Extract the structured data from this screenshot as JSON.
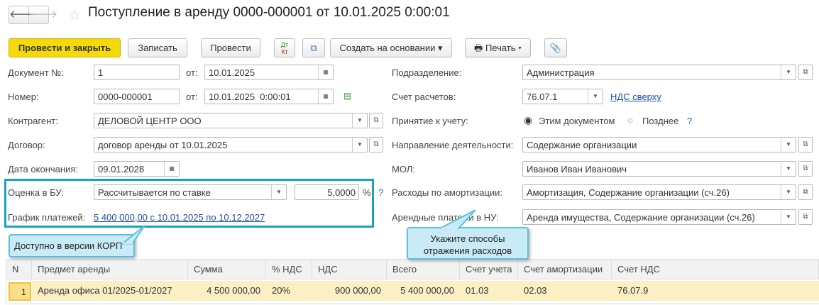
{
  "window": {
    "title": "Поступление в аренду 0000-000001 от 10.01.2025 0:00:01"
  },
  "toolbar": {
    "post_close": "Провести и закрыть",
    "save": "Записать",
    "post": "Провести",
    "dtkt_dt": "Дт",
    "dtkt_kt": "Кт",
    "create_based": "Создать на основании",
    "print": "Печать"
  },
  "form": {
    "doc_no_label": "Документ №:",
    "doc_no": "1",
    "from_label": "от:",
    "doc_date": "10.01.2025",
    "number_label": "Номер:",
    "number": "0000-000001",
    "number_date": "10.01.2025  0:00:01",
    "counterparty_label": "Контрагент:",
    "counterparty": "ДЕЛОВОЙ ЦЕНТР ООО",
    "contract_label": "Договор:",
    "contract": "договор аренды от 10.01.2025",
    "end_date_label": "Дата окончания:",
    "end_date": "09.01.2028",
    "valuation_label": "Оценка в БУ:",
    "valuation": "Рассчитывается по ставке",
    "rate": "5,0000",
    "percent": "%",
    "help": "?",
    "schedule_label": "График платежей:",
    "schedule": "5 400 000,00 с 10.01.2025 по 10.12.2027",
    "division_label": "Подразделение:",
    "division": "Администрация",
    "account_label": "Счет расчетов:",
    "account": "76.07.1",
    "vat_link": "НДС сверху",
    "acceptance_label": "Принятие к учету:",
    "acceptance_opt1": "Этим документом",
    "acceptance_opt2": "Позднее",
    "acceptance_help": "?",
    "activity_label": "Направление деятельности:",
    "activity": "Содержание организации",
    "mol_label": "МОЛ:",
    "mol": "Иванов Иван Иванович",
    "amort_label": "Расходы по амортизации:",
    "amort": "Амортизация, Содержание организации (сч.26)",
    "rent_nu_label": "Арендные платежи в НУ:",
    "rent_nu": "Аренда имущества, Содержание организации (сч.26)"
  },
  "callouts": {
    "korp": "Доступно в версии КОРП",
    "expenses_1": "Укажите способы",
    "expenses_2": "отражения расходов"
  },
  "table": {
    "headers": [
      "N",
      "Предмет аренды",
      "Сумма",
      "% НДС",
      "НДС",
      "Всего",
      "Счет учета",
      "Счет амортизации",
      "Счет НДС"
    ],
    "rows": [
      [
        "1",
        "Аренда офиса 01/2025-01/2027",
        "4 500 000,00",
        "20%",
        "900 000,00",
        "5 400 000,00",
        "01.03",
        "02.03",
        "76.07.9"
      ]
    ]
  },
  "colors": {
    "accent": "#f5d908",
    "highlight": "#17a2bd",
    "row": "#fbefc4"
  }
}
